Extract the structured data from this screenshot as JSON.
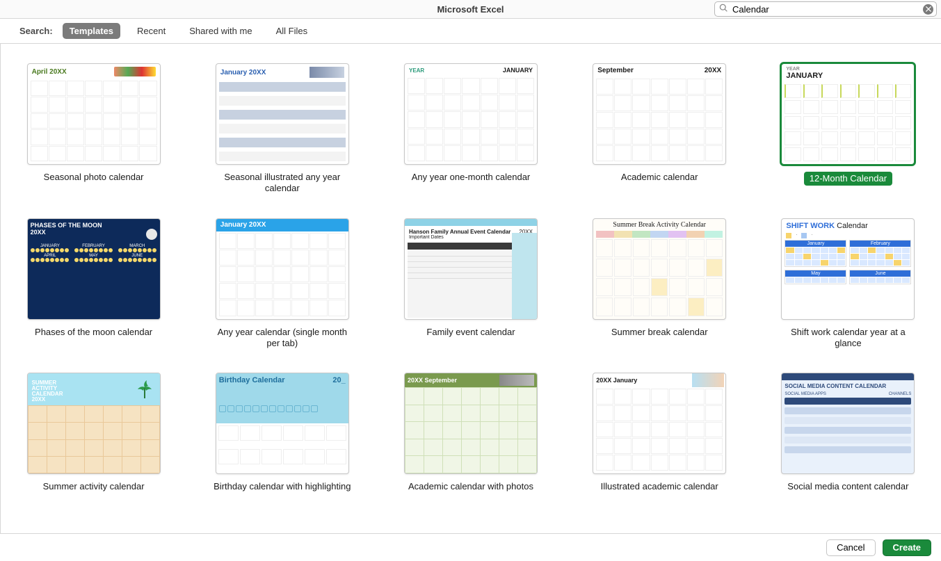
{
  "title": "Microsoft Excel",
  "search": {
    "value": "Calendar",
    "placeholder": "Search"
  },
  "tabs": {
    "label": "Search:",
    "items": [
      {
        "id": "templates",
        "label": "Templates",
        "active": true
      },
      {
        "id": "recent",
        "label": "Recent",
        "active": false
      },
      {
        "id": "shared",
        "label": "Shared with me",
        "active": false
      },
      {
        "id": "all",
        "label": "All Files",
        "active": false
      }
    ]
  },
  "templates": [
    {
      "id": "seasonal-photo",
      "label": "Seasonal photo calendar",
      "selected": false,
      "thumb": {
        "head": "April 20XX",
        "headColor": "#4a7a1f",
        "decor": "seasonal"
      }
    },
    {
      "id": "seasonal-illustrated",
      "label": "Seasonal illustrated any year calendar",
      "selected": false,
      "thumb": {
        "head": "January 20XX",
        "headColor": "#2a5fb0",
        "decor": "illustrated"
      }
    },
    {
      "id": "any-year-one-month",
      "label": "Any year one-month calendar",
      "selected": false,
      "thumb": {
        "headLeft": "YEAR",
        "headRight": "JANUARY"
      }
    },
    {
      "id": "academic",
      "label": "Academic calendar",
      "selected": false,
      "thumb": {
        "headLeft": "September",
        "headRight": "20XX"
      }
    },
    {
      "id": "12-month",
      "label": "12-Month Calendar",
      "selected": true,
      "thumb": {
        "headLeft": "YEAR",
        "headRight": "JANUARY"
      }
    },
    {
      "id": "phases-moon",
      "label": "Phases of the moon calendar",
      "selected": false,
      "thumb": {
        "title": "PHASES OF THE MOON",
        "sub": "20XX",
        "months": [
          "JANUARY",
          "FEBRUARY",
          "MARCH",
          "APRIL",
          "MAY",
          "JUNE"
        ]
      }
    },
    {
      "id": "any-year-single-tab",
      "label": "Any year calendar (single month per tab)",
      "selected": false,
      "thumb": {
        "head": "January 20XX",
        "headBg": "#2aa3e8"
      }
    },
    {
      "id": "family-event",
      "label": "Family event calendar",
      "selected": false,
      "thumb": {
        "title": "Hanson Family Annual Event Calendar",
        "sub": "Important Dates",
        "year": "20XX"
      }
    },
    {
      "id": "summer-break",
      "label": "Summer break calendar",
      "selected": false,
      "thumb": {
        "title": "Summer Break Activity Calendar"
      }
    },
    {
      "id": "shift-work",
      "label": "Shift work calendar year at a glance",
      "selected": false,
      "thumb": {
        "title": "SHIFT WORK",
        "title2": "Calendar",
        "months": [
          "January",
          "February",
          "May",
          "June"
        ]
      }
    },
    {
      "id": "summer-activity",
      "label": "Summer activity calendar",
      "selected": false,
      "thumb": {
        "line1": "SUMMER",
        "line2": "ACTIVITY",
        "line3": "CALENDAR",
        "line4": "20XX"
      }
    },
    {
      "id": "birthday",
      "label": "Birthday calendar with highlighting",
      "selected": false,
      "thumb": {
        "title": "Birthday Calendar",
        "year": "20_"
      }
    },
    {
      "id": "academic-photos",
      "label": "Academic calendar with photos",
      "selected": false,
      "thumb": {
        "title": "20XX September"
      }
    },
    {
      "id": "illustrated-academic",
      "label": "Illustrated academic calendar",
      "selected": false,
      "thumb": {
        "title": "20XX January"
      }
    },
    {
      "id": "social-media",
      "label": "Social media content calendar",
      "selected": false,
      "thumb": {
        "title": "SOCIAL MEDIA CONTENT CALENDAR",
        "sub1": "SOCIAL MEDIA APPS",
        "sub2": "CHANNELS"
      }
    }
  ],
  "footer": {
    "cancel": "Cancel",
    "create": "Create"
  }
}
